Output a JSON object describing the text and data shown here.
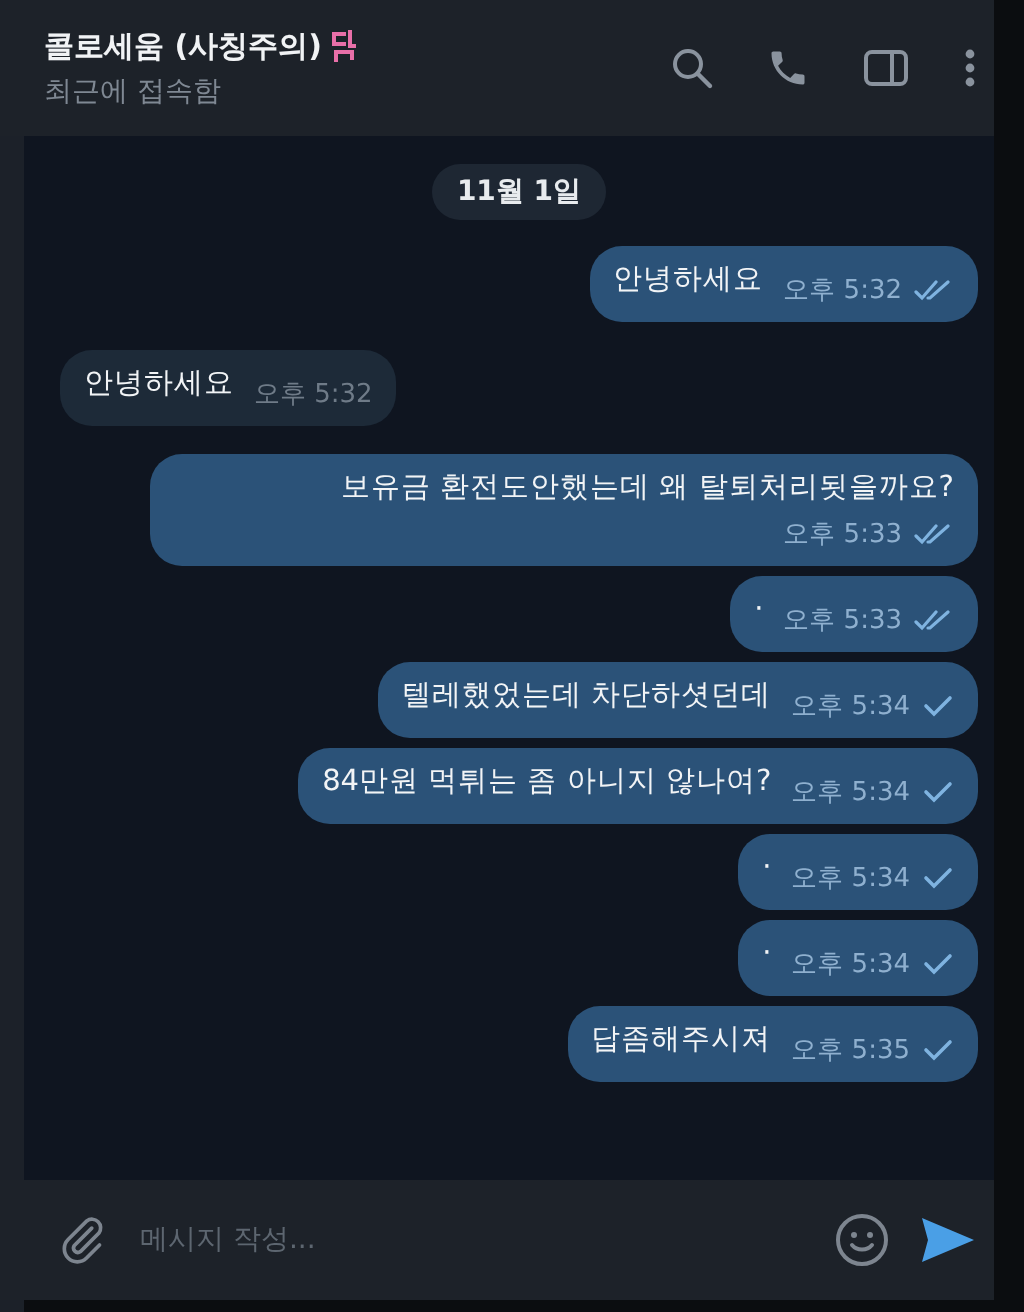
{
  "header": {
    "name": "콜로세움 (사칭주의)",
    "status": "최근에 접속함"
  },
  "date_chip": "11월 1일",
  "messages": [
    {
      "outgoing": true,
      "text": "안녕하세요",
      "time": "오후 5:32",
      "read": true
    },
    {
      "outgoing": false,
      "text": "안녕하세요",
      "time": "오후 5:32"
    },
    {
      "outgoing": true,
      "text": "보유금 환전도안했는데 왜 탈퇴처리됫을까요?",
      "time": "오후 5:33",
      "read": true
    },
    {
      "outgoing": true,
      "text": "·",
      "time": "오후 5:33",
      "read": true
    },
    {
      "outgoing": true,
      "text": "텔레했었는데 차단하셧던데",
      "time": "오후 5:34",
      "read": false
    },
    {
      "outgoing": true,
      "text": "84만원 먹튀는 좀 아니지 않나여?",
      "time": "오후 5:34",
      "read": false
    },
    {
      "outgoing": true,
      "text": "·",
      "time": "오후 5:34",
      "read": false
    },
    {
      "outgoing": true,
      "text": "·",
      "time": "오후 5:34",
      "read": false
    },
    {
      "outgoing": true,
      "text": "답좀해주시져",
      "time": "오후 5:35",
      "read": false
    }
  ],
  "composer": {
    "placeholder": "메시지 작성..."
  }
}
